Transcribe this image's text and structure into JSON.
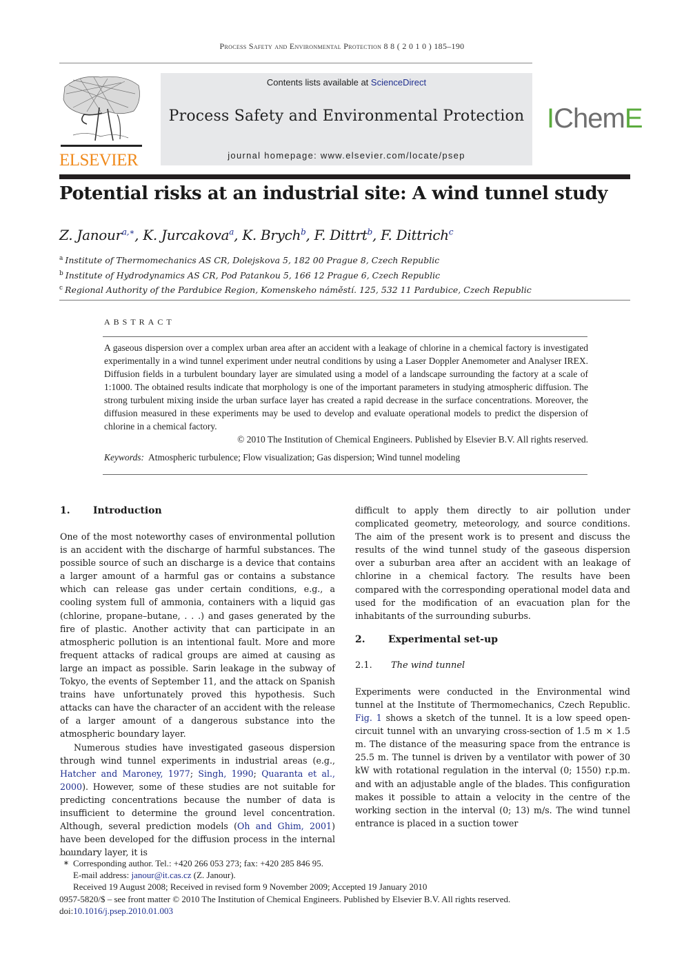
{
  "running_head": "Process Safety and Environmental Protection 8 8 ( 2 0 1 0 ) 185–190",
  "header": {
    "publisher_logo_text": "ELSEVIER",
    "contents_prefix": "Contents lists available at ",
    "contents_link": "ScienceDirect",
    "journal_name": "Process Safety and Environmental Protection",
    "homepage_label": "journal homepage: www.elsevier.com/locate/psep",
    "society_logo": {
      "gray_part_start": "I",
      "gray_part": "Chem",
      "green_part_end": "E"
    },
    "colors": {
      "elsevier_orange": "#f08a1c",
      "icheme_green": "#5aab3c",
      "link_blue": "#1f2f8f",
      "banner_gray": "#e7e8ea"
    }
  },
  "article": {
    "title": "Potential risks at an industrial site: A wind tunnel study",
    "authors": [
      {
        "name": "Z. Janour",
        "sup": "a,∗"
      },
      {
        "name": "K. Jurcakova",
        "sup": "a"
      },
      {
        "name": "K. Brych",
        "sup": "b"
      },
      {
        "name": "F. Dittrt",
        "sup": "b"
      },
      {
        "name": "F. Dittrich",
        "sup": "c"
      }
    ],
    "affiliations": [
      {
        "mark": "a",
        "text": "Institute of Thermomechanics AS CR, Dolejskova 5, 182 00 Prague 8, Czech Republic"
      },
      {
        "mark": "b",
        "text": "Institute of Hydrodynamics AS CR, Pod Patankou 5, 166 12 Prague 6, Czech Republic"
      },
      {
        "mark": "c",
        "text": "Regional Authority of the Pardubice Region, Komenskeho náměstí. 125, 532 11 Pardubice, Czech Republic"
      }
    ]
  },
  "abstract": {
    "heading": "ABSTRACT",
    "body": "A gaseous dispersion over a complex urban area after an accident with a leakage of chlorine in a chemical factory is investigated experimentally in a wind tunnel experiment under neutral conditions by using a Laser Doppler Anemometer and Analyser IREX. Diffusion fields in a turbulent boundary layer are simulated using a model of a landscape surrounding the factory at a scale of 1:1000. The obtained results indicate that morphology is one of the important parameters in studying atmospheric diffusion. The strong turbulent mixing inside the urban surface layer has created a rapid decrease in the surface concentrations. Moreover, the diffusion measured in these experiments may be used to develop and evaluate operational models to predict the dispersion of chlorine in a chemical factory.",
    "copyright": "© 2010 The Institution of Chemical Engineers. Published by Elsevier B.V. All rights reserved.",
    "keywords_label": "Keywords:",
    "keywords": "Atmospheric turbulence; Flow visualization; Gas dispersion; Wind tunnel modeling"
  },
  "body": {
    "sec1": {
      "num": "1.",
      "title": "Introduction",
      "p1": "One of the most noteworthy cases of environmental pollution is an accident with the discharge of harmful substances. The possible source of such an discharge is a device that contains a larger amount of a harmful gas or contains a substance which can release gas under certain conditions, e.g., a cooling system full of ammonia, containers with a liquid gas (chlorine, propane–butane, . . .) and gases generated by the fire of plastic. Another activity that can participate in an atmospheric pollution is an intentional fault. More and more frequent attacks of radical groups are aimed at causing as large an impact as possible. Sarin leakage in the subway of Tokyo, the events of September 11, and the attack on Spanish trains have unfortunately proved this hypothesis. Such attacks can have the character of an accident with the release of a larger amount of a dangerous substance into the atmospheric boundary layer.",
      "p2_a": "Numerous studies have investigated gaseous dispersion through wind tunnel experiments in industrial areas (e.g., ",
      "p2_cite1": "Hatcher and Maroney, 1977",
      "p2_sep1": "; ",
      "p2_cite2": "Singh, 1990",
      "p2_sep2": "; ",
      "p2_cite3": "Quaranta et al., 2000",
      "p2_b": "). However, some of these studies are not suitable for predicting concentrations because the number of data is insufficient to determine the ground level concentration. Although, several prediction models (",
      "p2_cite4": "Oh and Ghim, 2001",
      "p2_c": ") have been developed for the diffusion process in the internal boundary layer, it is",
      "p2_cont": "difficult to apply them directly to air pollution under complicated geometry, meteorology, and source conditions. The aim of the present work is to present and discuss the results of the wind tunnel study of the gaseous dispersion over a suburban area after an accident with an leakage of chlorine in a chemical factory. The results have been compared with the corresponding operational model data and used for the modification of an evacuation plan for the inhabitants of the surrounding suburbs."
    },
    "sec2": {
      "num": "2.",
      "title": "Experimental set-up",
      "sub1_num": "2.1.",
      "sub1_title": "The wind tunnel",
      "p1_a": "Experiments were conducted in the Environmental wind tunnel at the Institute of Thermomechanics, Czech Republic. ",
      "p1_fig": "Fig. 1",
      "p1_b": " shows a sketch of the tunnel. It is a low speed open-circuit tunnel with an unvarying cross-section of 1.5 m × 1.5 m. The distance of the measuring space from the entrance is 25.5 m. The tunnel is driven by a ventilator with power of 30 kW with rotational regulation in the interval (0; 1550) r.p.m. and with an adjustable angle of the blades. This configuration makes it possible to attain a velocity in the centre of the working section in the interval (0; 13) m/s. The wind tunnel entrance is placed in a suction tower"
    }
  },
  "footnotes": {
    "star": "∗",
    "corresponding": "Corresponding author. Tel.: +420 266 053 273; fax: +420 285 846 95.",
    "email_label": "E-mail address: ",
    "email": "janour@it.cas.cz",
    "email_suffix": " (Z. Janour).",
    "received": "Received 19 August 2008; Received in revised form 9 November 2009; Accepted 19 January 2010",
    "front_matter": "0957-5820/$ – see front matter © 2010 The Institution of Chemical Engineers. Published by Elsevier B.V. All rights reserved.",
    "doi_label": "doi:",
    "doi": "10.1016/j.psep.2010.01.003"
  }
}
